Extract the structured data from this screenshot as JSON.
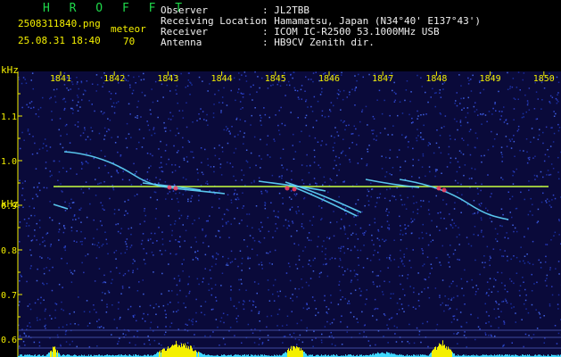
{
  "header": {
    "app_title": "H R O F F T",
    "filename": "2508311840.png",
    "timestamp": "25.08.31 18:40",
    "mode_label": "meteor",
    "count": "70",
    "fields": [
      {
        "label": "Observer",
        "value": ": JL2TBB"
      },
      {
        "label": "Receiving Location",
        "value": ": Hamamatsu, Japan (N34°40' E137°43')"
      },
      {
        "label": "Receiver",
        "value": ": ICOM IC-R2500 53.1000MHz USB"
      },
      {
        "label": "Antenna",
        "value": ": HB9CV Zenith dir."
      }
    ]
  },
  "spectrogram": {
    "y_unit_top": "kHz",
    "y_unit_bottom": "kHz",
    "y_ticks": [
      "1.1",
      "1.0",
      "0.9",
      "0.8",
      "0.7",
      "0.6"
    ],
    "x_ticks": [
      "1841",
      "1842",
      "1843",
      "1844",
      "1845",
      "1846",
      "1847",
      "1848",
      "1849",
      "1850"
    ],
    "carrier_khz": 0.94,
    "colors": {
      "background": "#0a0a3a",
      "axis": "#f4f000",
      "carrier": "#c8ff40",
      "trace": "#60d8ff",
      "peak": "#ff4060"
    }
  }
}
